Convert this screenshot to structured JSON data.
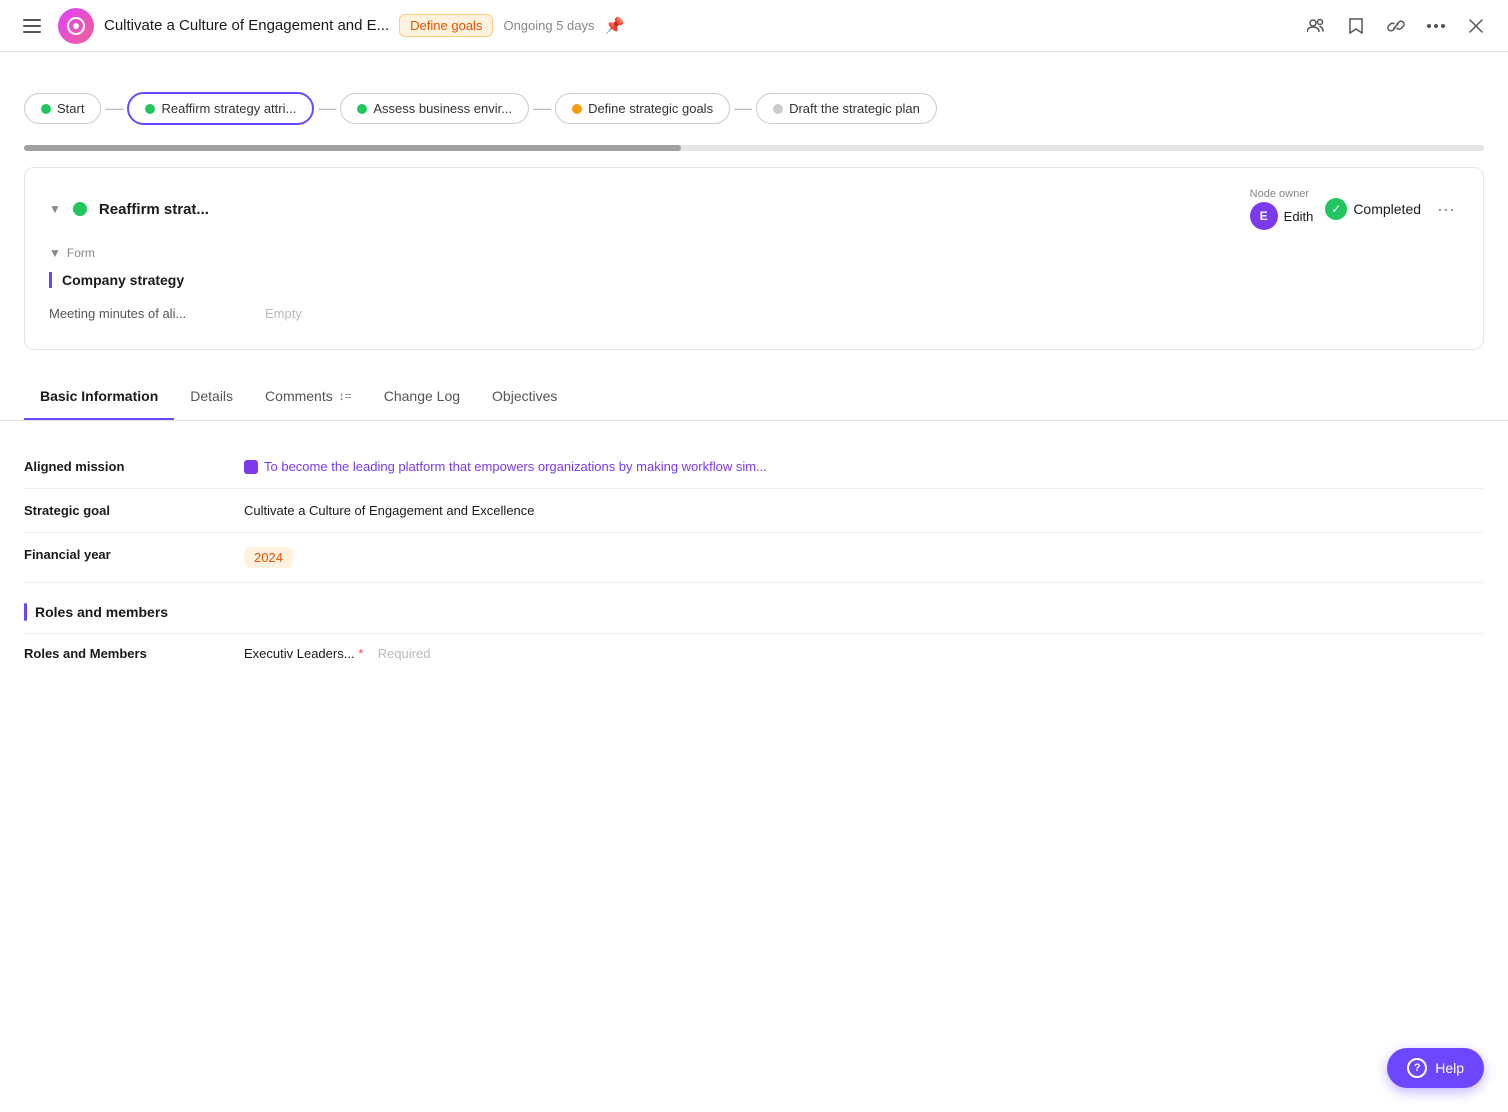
{
  "header": {
    "title": "Cultivate a Culture of Engagement and E...",
    "badge": "Define goals",
    "status": "Ongoing 5 days"
  },
  "flow": {
    "nodes": [
      {
        "id": "start",
        "label": "Start",
        "dot": "green",
        "active": false
      },
      {
        "id": "reaffirm",
        "label": "Reaffirm strategy attri...",
        "dot": "green",
        "active": true
      },
      {
        "id": "assess",
        "label": "Assess business envir...",
        "dot": "green",
        "active": false
      },
      {
        "id": "define",
        "label": "Define strategic goals",
        "dot": "yellow",
        "active": false
      },
      {
        "id": "draft",
        "label": "Draft the strategic plan",
        "dot": "gray",
        "active": false
      }
    ]
  },
  "node_card": {
    "title": "Reaffirm strat...",
    "owner_label": "Node owner",
    "owner_name": "Edith",
    "owner_initial": "E",
    "completed_label": "Completed",
    "form_section": "Form",
    "company_strategy": "Company strategy",
    "meeting_minutes": "Meeting minutes of ali...",
    "meeting_value": "Empty"
  },
  "tabs": [
    {
      "id": "basic",
      "label": "Basic Information",
      "active": true
    },
    {
      "id": "details",
      "label": "Details",
      "active": false
    },
    {
      "id": "comments",
      "label": "Comments",
      "badge": "↕=",
      "active": false
    },
    {
      "id": "changelog",
      "label": "Change Log",
      "active": false
    },
    {
      "id": "objectives",
      "label": "Objectives",
      "active": false
    }
  ],
  "basic_info": {
    "aligned_mission_label": "Aligned mission",
    "aligned_mission_value": "To become the leading platform that empowers organizations by making workflow sim...",
    "strategic_goal_label": "Strategic goal",
    "strategic_goal_value": "Cultivate a Culture of Engagement and Excellence",
    "financial_year_label": "Financial year",
    "financial_year_value": "2024",
    "roles_section_title": "Roles and members",
    "roles_members_label": "Roles and Members",
    "roles_members_value": "Executiv Leaders...",
    "roles_required_placeholder": "Required"
  },
  "help_button": {
    "label": "Help",
    "icon": "?"
  }
}
